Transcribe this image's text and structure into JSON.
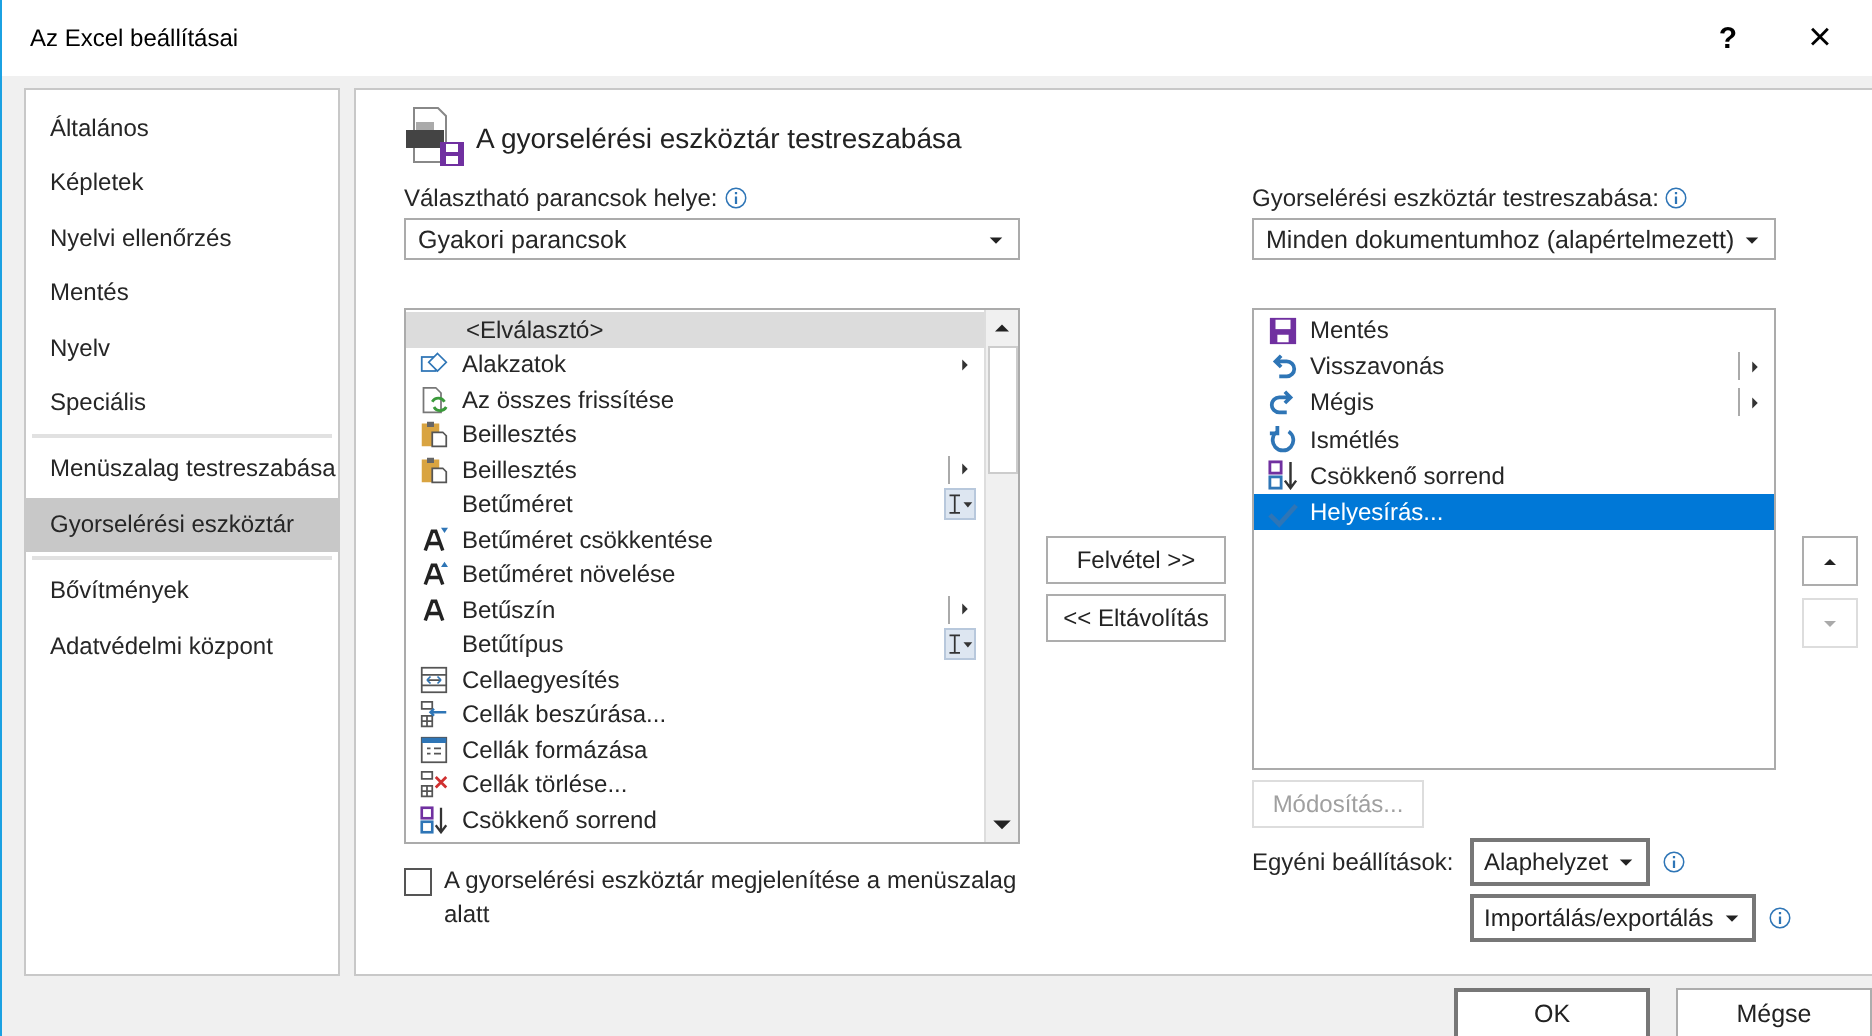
{
  "window": {
    "title": "Az Excel beállításai",
    "help": "?",
    "close": "×"
  },
  "sidebar": {
    "groups": [
      [
        {
          "label": "Általános",
          "selected": false
        },
        {
          "label": "Képletek",
          "selected": false
        },
        {
          "label": "Nyelvi ellenőrzés",
          "selected": false
        },
        {
          "label": "Mentés",
          "selected": false
        },
        {
          "label": "Nyelv",
          "selected": false
        },
        {
          "label": "Speciális",
          "selected": false
        }
      ],
      [
        {
          "label": "Menüszalag testreszabása",
          "selected": false
        },
        {
          "label": "Gyorselérési eszköztár",
          "selected": true
        }
      ],
      [
        {
          "label": "Bővítmények",
          "selected": false
        },
        {
          "label": "Adatvédelmi központ",
          "selected": false
        }
      ]
    ]
  },
  "heading": "A gyorselérési eszköztár testreszabása",
  "commands_label": "Választható parancsok helye:",
  "commands_source": "Gyakori parancsok",
  "commands": [
    {
      "label": "<Elválasztó>",
      "kind": "plain",
      "selected": true
    },
    {
      "label": "Alakzatok",
      "kind": "submenu",
      "selected": false
    },
    {
      "label": "Az összes frissítése",
      "kind": "plain",
      "selected": false
    },
    {
      "label": "Beillesztés",
      "kind": "plain",
      "selected": false
    },
    {
      "label": "Beillesztés",
      "kind": "split",
      "selected": false
    },
    {
      "label": "Betűméret",
      "kind": "font-box",
      "selected": false
    },
    {
      "label": "Betűméret csökkentése",
      "kind": "plain",
      "selected": false
    },
    {
      "label": "Betűméret növelése",
      "kind": "plain",
      "selected": false
    },
    {
      "label": "Betűszín",
      "kind": "split",
      "selected": false
    },
    {
      "label": "Betűtípus",
      "kind": "font-box",
      "selected": false
    },
    {
      "label": "Cellaegyesítés",
      "kind": "plain",
      "selected": false
    },
    {
      "label": "Cellák beszúrása...",
      "kind": "plain",
      "selected": false
    },
    {
      "label": "Cellák formázása",
      "kind": "plain",
      "selected": false
    },
    {
      "label": "Cellák törlése...",
      "kind": "plain",
      "selected": false
    },
    {
      "label": "Csökkenő sorrend",
      "kind": "plain",
      "selected": false
    }
  ],
  "show_below_ribbon": {
    "label": "A gyorselérési eszköztár megjelenítése a menüszalag alatt",
    "checked": false
  },
  "add_button": "Felvétel >>",
  "remove_button": "<< Eltávolítás",
  "toolbar_label": "Gyorselérési eszköztár testreszabása:",
  "toolbar_target": "Minden dokumentumhoz (alapértelmezett)",
  "toolbar_items": [
    {
      "label": "Mentés",
      "kind": "plain",
      "selected": false
    },
    {
      "label": "Visszavonás",
      "kind": "split",
      "selected": false
    },
    {
      "label": "Mégis",
      "kind": "split",
      "selected": false
    },
    {
      "label": "Ismétlés",
      "kind": "plain",
      "selected": false
    },
    {
      "label": "Csökkenő sorrend",
      "kind": "plain",
      "selected": false
    },
    {
      "label": "Helyesírás...",
      "kind": "plain",
      "selected": true
    }
  ],
  "move_up": {
    "disabled": false
  },
  "move_down": {
    "disabled": true
  },
  "modify_button": {
    "label": "Módosítás...",
    "disabled": true
  },
  "custom_label": "Egyéni beállítások:",
  "reset_button": "Alaphelyzet",
  "import_export_button": "Importálás/exportálás",
  "ok_button": "OK",
  "cancel_button": "Mégse"
}
